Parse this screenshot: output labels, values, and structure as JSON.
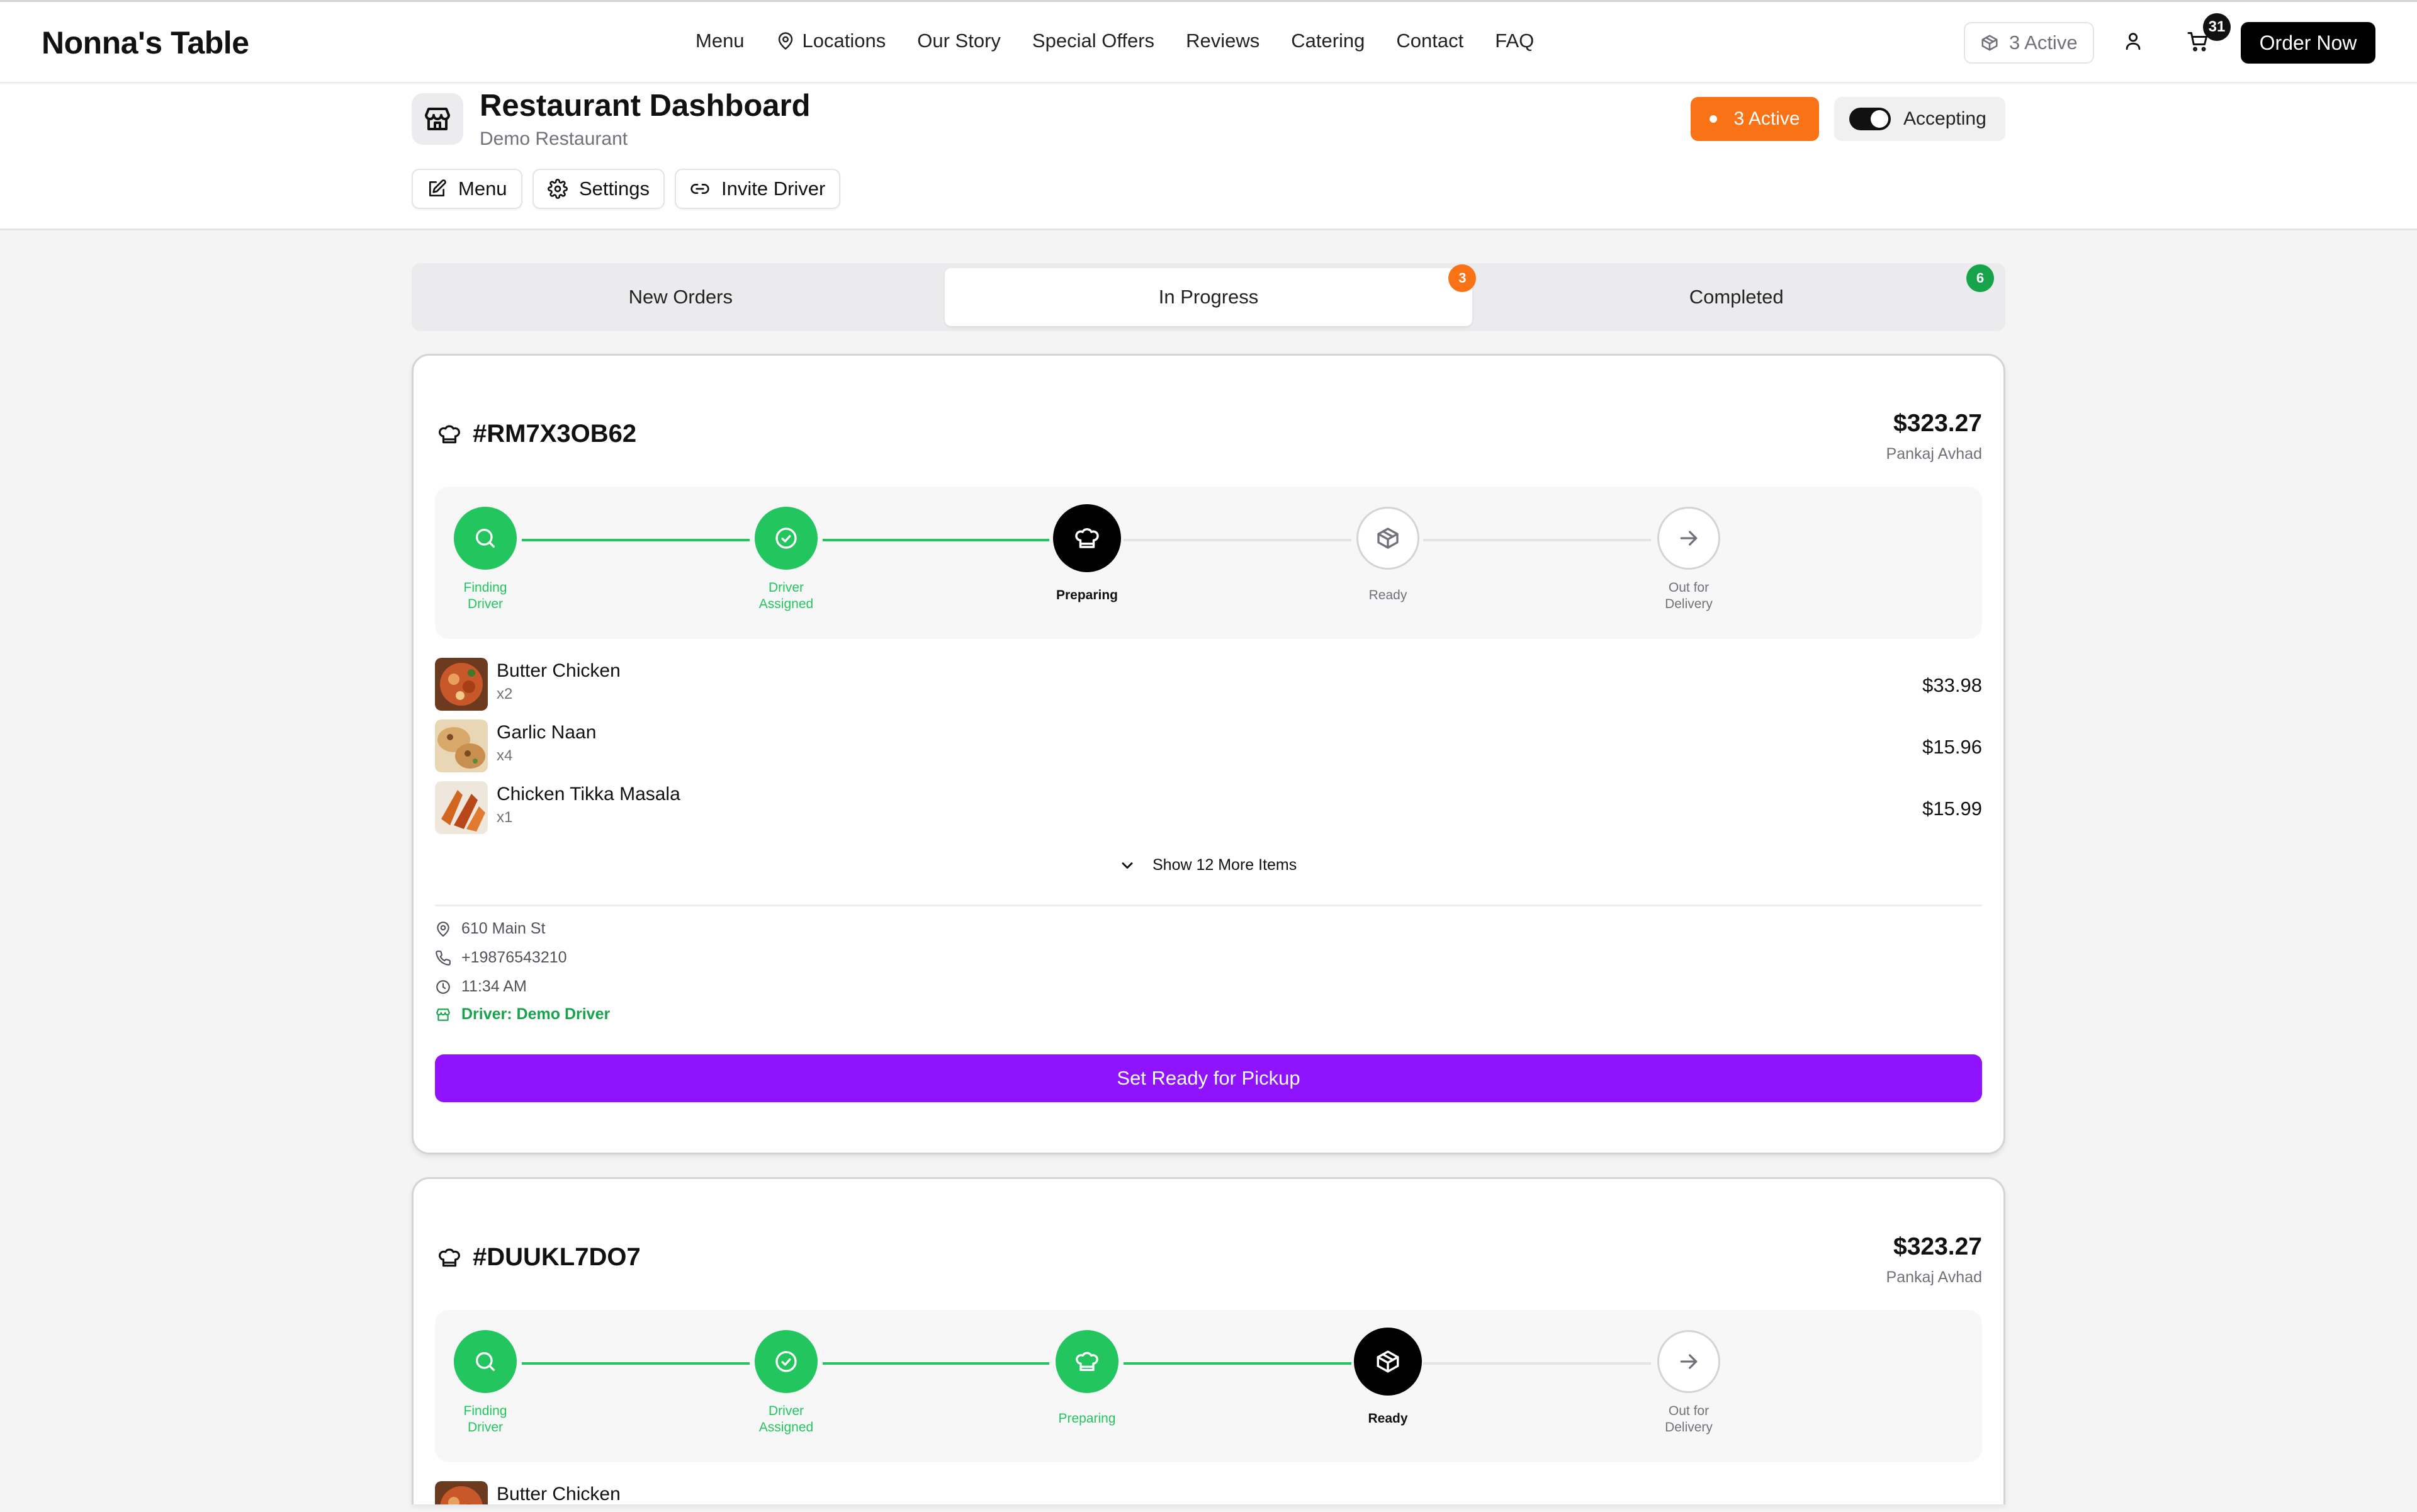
{
  "brand": "Nonna's Table",
  "nav": {
    "links": [
      "Menu",
      "Locations",
      "Our Story",
      "Special Offers",
      "Reviews",
      "Catering",
      "Contact",
      "FAQ"
    ],
    "active_label": "3 Active",
    "cart_count": "31",
    "order_now": "Order Now"
  },
  "dashboard": {
    "title": "Restaurant Dashboard",
    "subtitle": "Demo Restaurant",
    "buttons": {
      "menu": "Menu",
      "settings": "Settings",
      "invite": "Invite Driver"
    },
    "active_badge": "3 Active",
    "accepting_label": "Accepting",
    "accepting_on": true
  },
  "tabs": [
    {
      "label": "New Orders",
      "badge": ""
    },
    {
      "label": "In Progress",
      "badge": "3"
    },
    {
      "label": "Completed",
      "badge": "6"
    }
  ],
  "colors": {
    "accent_orange": "#f97316",
    "success_green": "#22c55e",
    "primary_purple": "#9013fe"
  },
  "orders": [
    {
      "id": "#RM7X3OB62",
      "total": "$323.27",
      "customer": "Pankaj Avhad",
      "steps": [
        {
          "label_1": "Finding",
          "label_2": "Driver",
          "status": "done",
          "icon": "search-icon"
        },
        {
          "label_1": "Driver",
          "label_2": "Assigned",
          "status": "done",
          "icon": "check-circle-icon"
        },
        {
          "label_1": "Preparing",
          "label_2": "",
          "status": "current",
          "icon": "chef-hat-icon"
        },
        {
          "label_1": "Ready",
          "label_2": "",
          "status": "pending",
          "icon": "package-icon"
        },
        {
          "label_1": "Out for",
          "label_2": "Delivery",
          "status": "pending",
          "icon": "arrow-right-icon"
        }
      ],
      "items": [
        {
          "name": "Butter Chicken",
          "qty": "x2",
          "price": "$33.98"
        },
        {
          "name": "Garlic Naan",
          "qty": "x4",
          "price": "$15.96"
        },
        {
          "name": "Chicken Tikka Masala",
          "qty": "x1",
          "price": "$15.99"
        }
      ],
      "show_more": "Show 12 More Items",
      "address": "610 Main St",
      "phone": "+19876543210",
      "time": "11:34 AM",
      "driver": "Driver: Demo Driver",
      "action": "Set Ready for Pickup"
    },
    {
      "id": "#DUUKL7DO7",
      "total": "$323.27",
      "customer": "Pankaj Avhad",
      "steps": [
        {
          "label_1": "Finding",
          "label_2": "Driver",
          "status": "done",
          "icon": "search-icon"
        },
        {
          "label_1": "Driver",
          "label_2": "Assigned",
          "status": "done",
          "icon": "check-circle-icon"
        },
        {
          "label_1": "Preparing",
          "label_2": "",
          "status": "done",
          "icon": "chef-hat-icon"
        },
        {
          "label_1": "Ready",
          "label_2": "",
          "status": "current",
          "icon": "package-icon"
        },
        {
          "label_1": "Out for",
          "label_2": "Delivery",
          "status": "pending",
          "icon": "arrow-right-icon"
        }
      ],
      "items": [
        {
          "name": "Butter Chicken"
        }
      ]
    }
  ]
}
